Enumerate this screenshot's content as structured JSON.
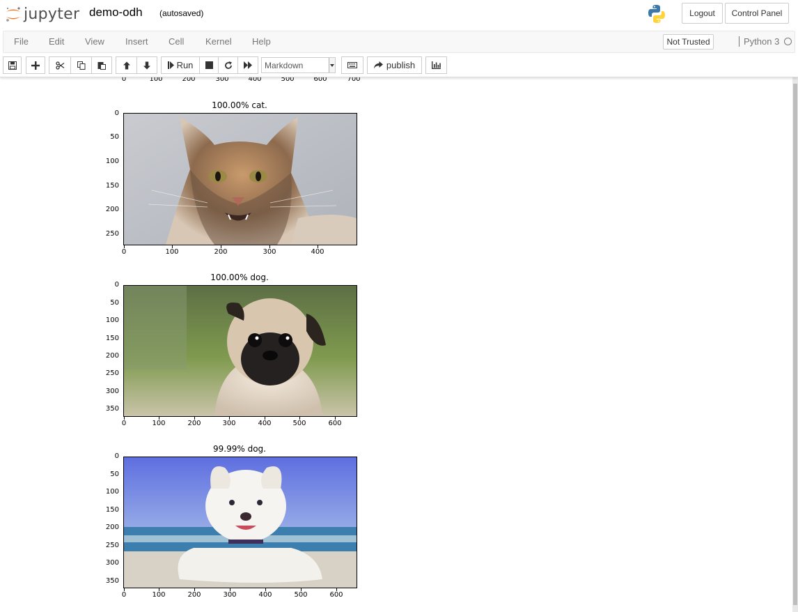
{
  "header": {
    "logo_text": "jupyter",
    "notebook_name": "demo-odh",
    "autosave_status": "(autosaved)",
    "logout_label": "Logout",
    "control_panel_label": "Control Panel"
  },
  "menubar": {
    "items": [
      "File",
      "Edit",
      "View",
      "Insert",
      "Cell",
      "Kernel",
      "Help"
    ],
    "trust_label": "Not Trusted",
    "kernel_name": "Python 3"
  },
  "toolbar": {
    "run_label": "Run",
    "cell_type": "Markdown",
    "publish_label": "publish",
    "icons": [
      "save-icon",
      "plus-icon",
      "cut-icon",
      "copy-icon",
      "paste-icon",
      "arrow-up-icon",
      "arrow-down-icon",
      "step-forward-icon",
      "stop-icon",
      "refresh-icon",
      "fast-forward-icon",
      "keyboard-icon",
      "share-icon",
      "bar-chart-icon"
    ]
  },
  "output": {
    "top_partial_x_ticks": [
      "0",
      "100",
      "200",
      "300",
      "400",
      "500",
      "600",
      "700"
    ],
    "plots": [
      {
        "title": "100.00% cat.",
        "x_ticks": [
          "0",
          "100",
          "200",
          "300",
          "400"
        ],
        "y_ticks": [
          "0",
          "50",
          "100",
          "150",
          "200",
          "250"
        ],
        "image_subject": "cat"
      },
      {
        "title": "100.00% dog.",
        "x_ticks": [
          "0",
          "100",
          "200",
          "300",
          "400",
          "500",
          "600"
        ],
        "y_ticks": [
          "0",
          "50",
          "100",
          "150",
          "200",
          "250",
          "300",
          "350"
        ],
        "image_subject": "pug"
      },
      {
        "title": "99.99% dog.",
        "x_ticks": [
          "0",
          "100",
          "200",
          "300",
          "400",
          "500",
          "600"
        ],
        "y_ticks": [
          "0",
          "50",
          "100",
          "150",
          "200",
          "250",
          "300",
          "350"
        ],
        "image_subject": "white-puppy-on-beach"
      }
    ]
  },
  "colors": {
    "jupyter_orange": "#f37726",
    "menubar_bg": "#f8f8f8",
    "python_blue": "#3c78aa",
    "python_yellow": "#ffd43b"
  }
}
